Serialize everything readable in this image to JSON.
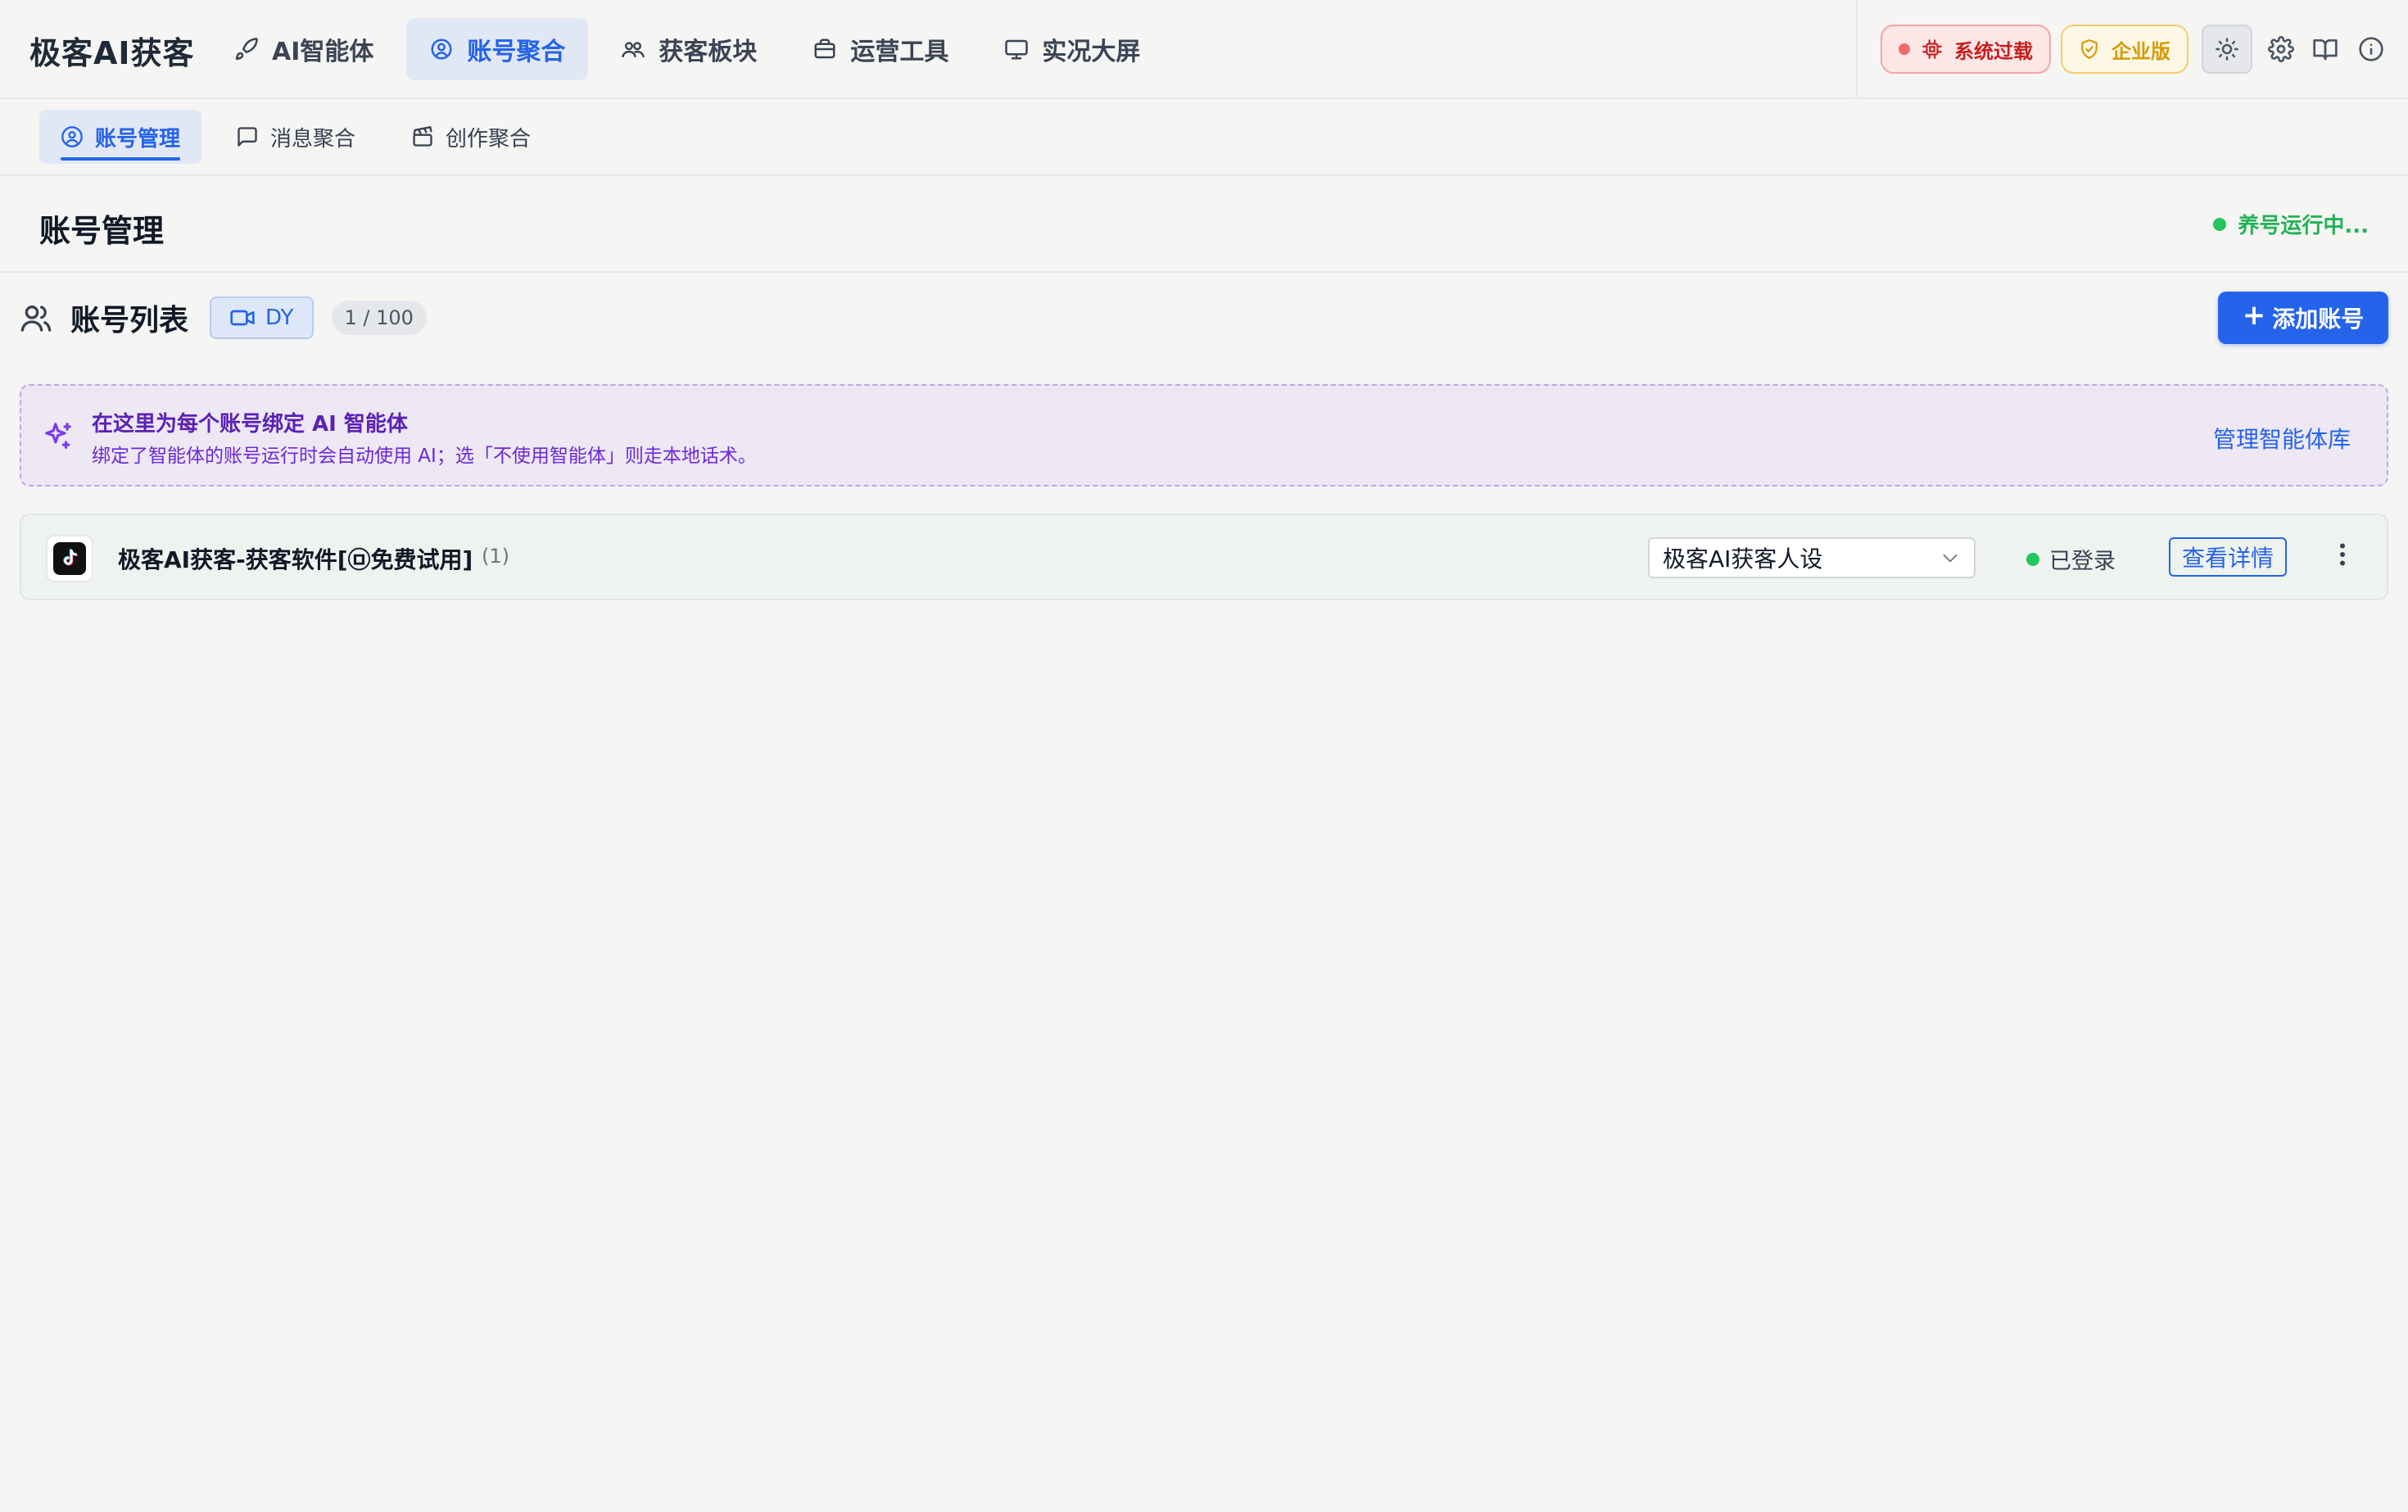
{
  "app": {
    "brand": "极客AI获客"
  },
  "nav": {
    "items": [
      {
        "label": "AI智能体",
        "icon": "rocket-icon",
        "active": false
      },
      {
        "label": "账号聚合",
        "icon": "globe-user-icon",
        "active": true
      },
      {
        "label": "获客板块",
        "icon": "users-icon",
        "active": false
      },
      {
        "label": "运营工具",
        "icon": "toolbox-icon",
        "active": false
      },
      {
        "label": "实况大屏",
        "icon": "monitor-icon",
        "active": false
      }
    ]
  },
  "topbar": {
    "system_overload": "系统过载",
    "enterprise": "企业版",
    "icons": [
      "sun-icon",
      "gear-icon",
      "book-icon",
      "info-icon"
    ]
  },
  "subtabs": {
    "items": [
      {
        "label": "账号管理",
        "icon": "user-circle-icon",
        "active": true
      },
      {
        "label": "消息聚合",
        "icon": "message-icon",
        "active": false
      },
      {
        "label": "创作聚合",
        "icon": "clapperboard-icon",
        "active": false
      }
    ]
  },
  "page": {
    "title": "账号管理",
    "running_status": "养号运行中..."
  },
  "account_list": {
    "title": "账号列表",
    "platform": "DY",
    "count": "1 / 100",
    "add_button": "添加账号"
  },
  "banner": {
    "title": "在这里为每个账号绑定 AI 智能体",
    "description": "绑定了智能体的账号运行时会自动使用 AI；选「不使用智能体」则走本地话术。",
    "link": "管理智能体库"
  },
  "accounts": [
    {
      "name": "极客AI获客-获客软件[㉤免费试用]",
      "count": "(1)",
      "agent": "极客AI获客人设",
      "status": "已登录",
      "detail_button": "查看详情"
    }
  ],
  "colors": {
    "primary": "#2563eb",
    "success": "#22c55e",
    "danger": "#c81e1e",
    "warning": "#d69a06",
    "ai_purple": "#6d28d9"
  }
}
